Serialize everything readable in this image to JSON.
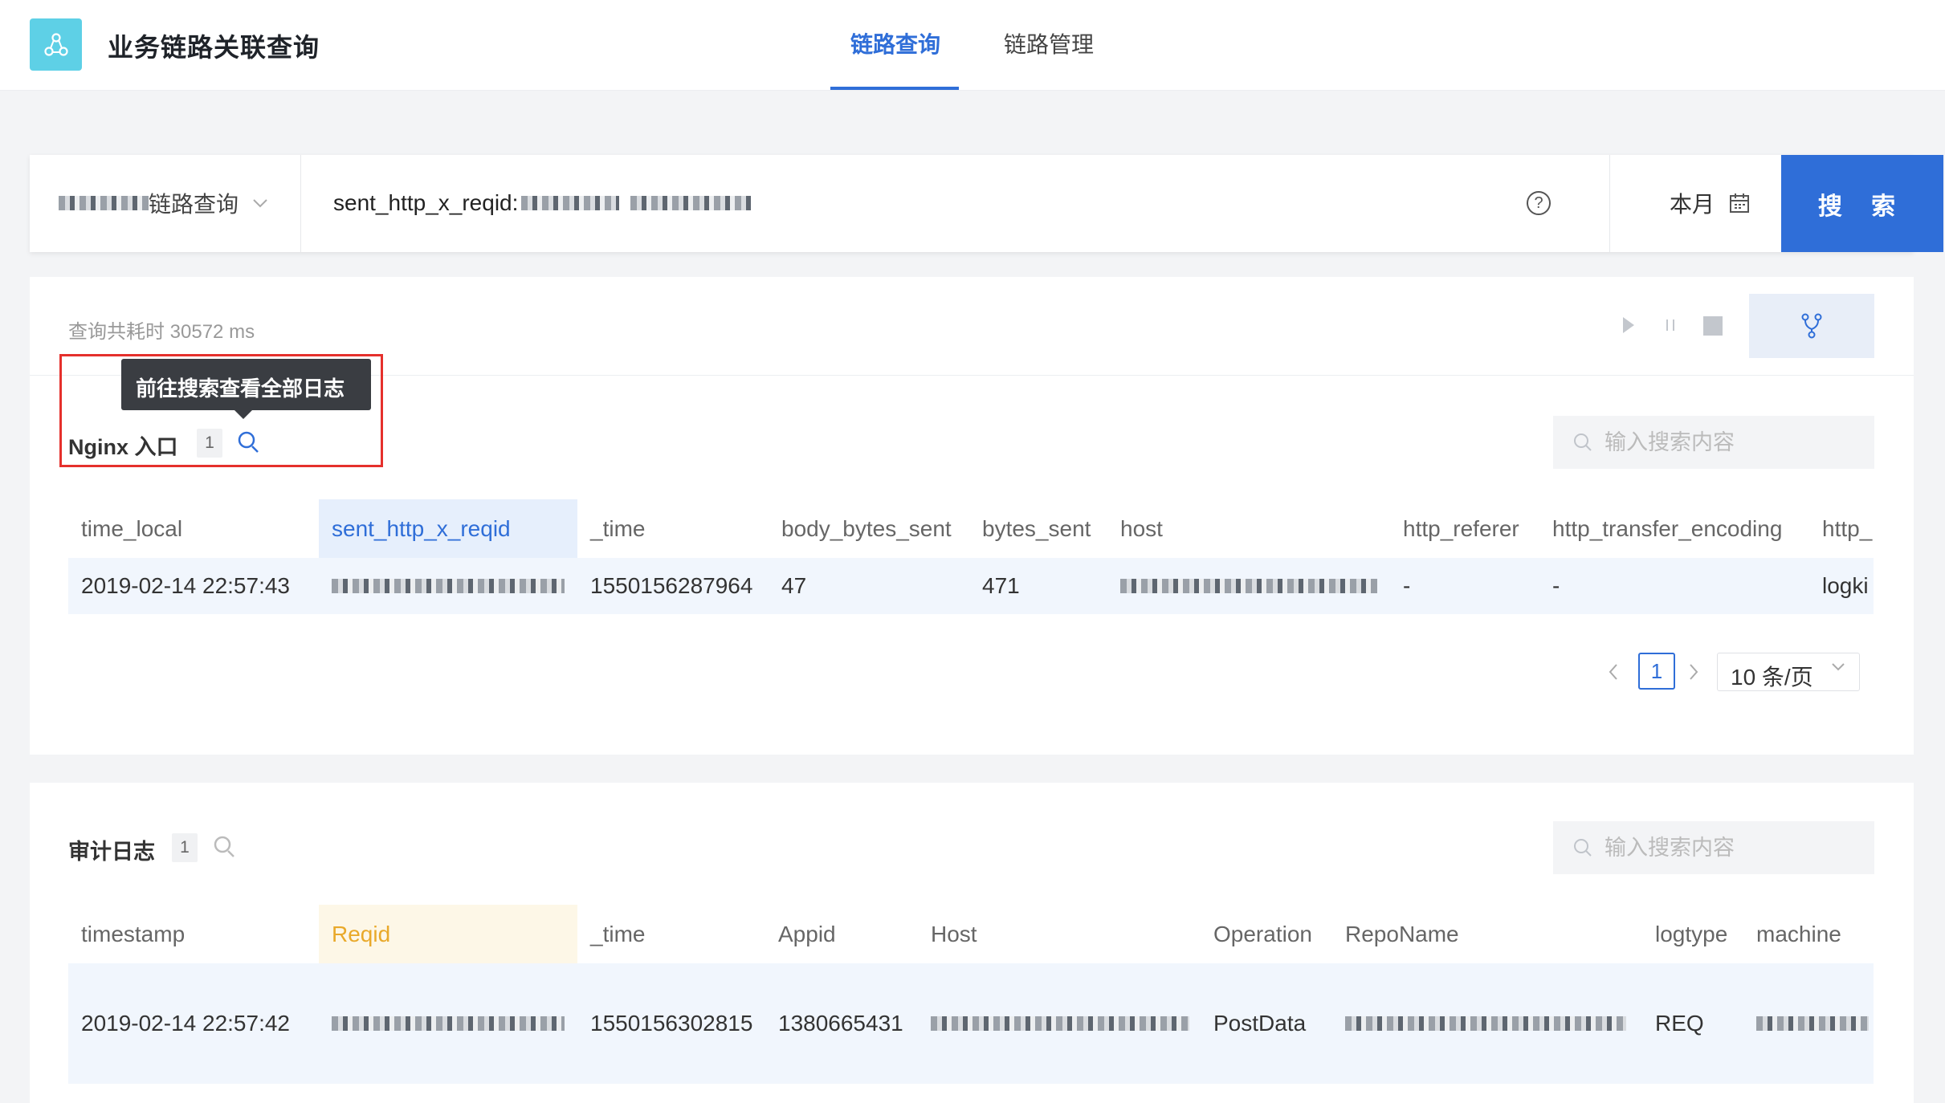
{
  "header": {
    "app_title": "业务链路关联查询",
    "tabs": [
      {
        "label": "链路查询",
        "active": true
      },
      {
        "label": "链路管理",
        "active": false
      }
    ]
  },
  "search": {
    "link_type_suffix": "链路查询",
    "query_prefix": "sent_http_x_reqid:",
    "date_range": "本月",
    "button_label": "搜 索"
  },
  "result": {
    "elapsed_label": "查询共耗时 30572 ms"
  },
  "nginx": {
    "tooltip": "前往搜索查看全部日志",
    "title": "Nginx 入口",
    "count": "1",
    "filter_placeholder": "输入搜索内容",
    "columns": [
      "time_local",
      "sent_http_x_reqid",
      "_time",
      "body_bytes_sent",
      "bytes_sent",
      "host",
      "http_referer",
      "http_transfer_encoding",
      "http_"
    ],
    "row": {
      "time_local": "2019-02-14 22:57:43",
      "_time": "1550156287964",
      "body_bytes_sent": "47",
      "bytes_sent": "471",
      "http_referer": "-",
      "http_transfer_encoding": "-",
      "http_": "logki"
    },
    "pagination": {
      "current": "1",
      "page_size": "10 条/页"
    }
  },
  "audit": {
    "title": "审计日志",
    "count": "1",
    "filter_placeholder": "输入搜索内容",
    "columns": [
      "timestamp",
      "Reqid",
      "_time",
      "Appid",
      "Host",
      "Operation",
      "RepoName",
      "logtype",
      "machine"
    ],
    "row": {
      "timestamp": "2019-02-14 22:57:42",
      "_time": "1550156302815",
      "Appid": "1380665431",
      "Operation": "PostData",
      "logtype": "REQ"
    }
  },
  "colors": {
    "primary": "#2f6ed8",
    "logo_bg": "#5ed0e6",
    "highlight_border": "#e5302c",
    "reqid_highlight": "#e9a92a"
  }
}
